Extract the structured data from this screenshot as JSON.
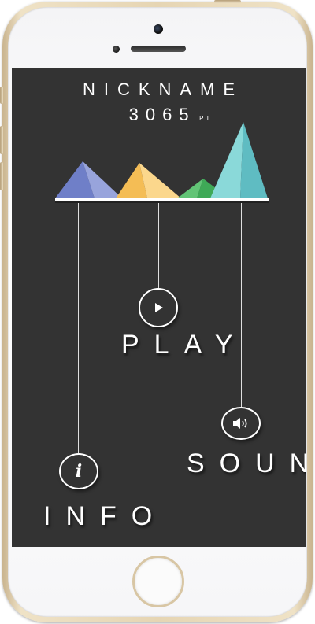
{
  "header": {
    "nickname": "NICKNAME",
    "score": "3065",
    "score_unit": "PT"
  },
  "menu": {
    "play_label": "PLAY",
    "sound_label": "SOUND",
    "info_label": "INFO",
    "info_glyph": "i"
  },
  "icons": {
    "play": "play-icon",
    "sound": "speaker-icon",
    "info": "info-icon"
  },
  "colors": {
    "screen_bg": "#333333",
    "peak_blue": "#7b8ad0",
    "peak_yellow": "#f7c766",
    "peak_green": "#52b86a",
    "peak_teal": "#7fd3d3",
    "phone_gold": "#e6d5b3"
  }
}
